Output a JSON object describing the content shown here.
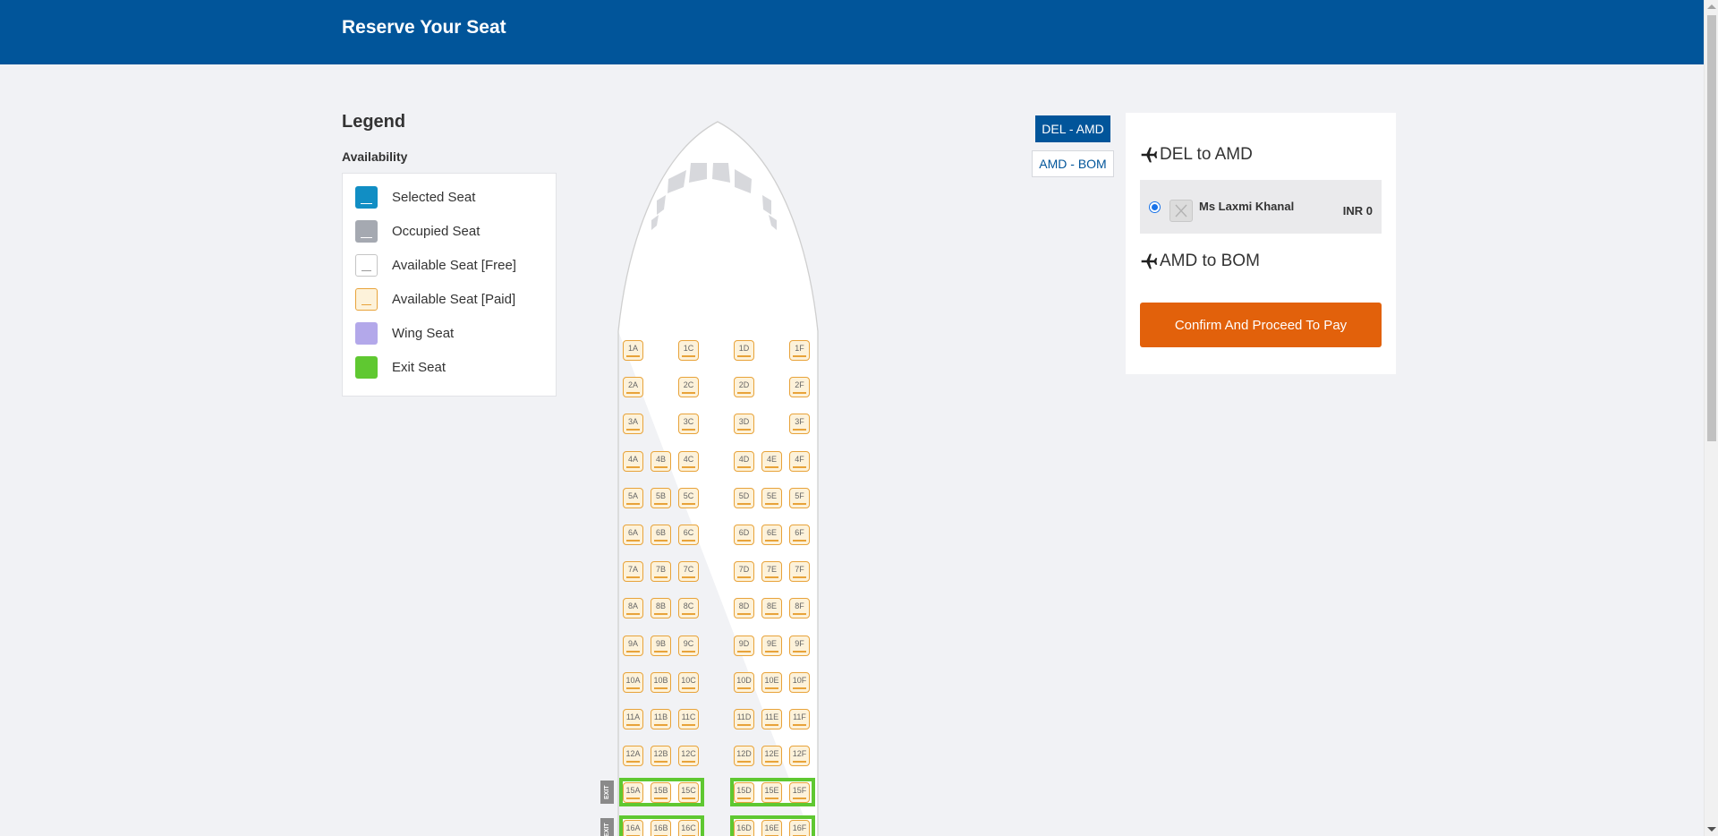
{
  "header": {
    "title": "Reserve Your Seat"
  },
  "legend": {
    "title": "Legend",
    "subtitle": "Availability",
    "items": [
      {
        "label": "Selected Seat",
        "color": "#118ec4",
        "line": "#ffffff"
      },
      {
        "label": "Occupied Seat",
        "color": "#a5a9b1",
        "line": "#ffffff"
      },
      {
        "label": "Available Seat [Free]",
        "color": "#ffffff",
        "line": "#9a9a9a"
      },
      {
        "label": "Available Seat [Paid]",
        "color": "#fdf2da",
        "line": "#e8a33a"
      },
      {
        "label": "Wing Seat",
        "color": "#b3a8ea",
        "line": ""
      },
      {
        "label": "Exit Seat",
        "color": "#5fc831",
        "line": ""
      }
    ]
  },
  "seatmap": {
    "exit_label": "EXIT",
    "rows": [
      {
        "row": "1",
        "seats": [
          "1A",
          "1C",
          "1D",
          "1F"
        ]
      },
      {
        "row": "2",
        "seats": [
          "2A",
          "2C",
          "2D",
          "2F"
        ]
      },
      {
        "row": "3",
        "seats": [
          "3A",
          "3C",
          "3D",
          "3F"
        ]
      },
      {
        "row": "4",
        "seats": [
          "4A",
          "4B",
          "4C",
          "4D",
          "4E",
          "4F"
        ]
      },
      {
        "row": "5",
        "seats": [
          "5A",
          "5B",
          "5C",
          "5D",
          "5E",
          "5F"
        ]
      },
      {
        "row": "6",
        "seats": [
          "6A",
          "6B",
          "6C",
          "6D",
          "6E",
          "6F"
        ]
      },
      {
        "row": "7",
        "seats": [
          "7A",
          "7B",
          "7C",
          "7D",
          "7E",
          "7F"
        ]
      },
      {
        "row": "8",
        "seats": [
          "8A",
          "8B",
          "8C",
          "8D",
          "8E",
          "8F"
        ]
      },
      {
        "row": "9",
        "seats": [
          "9A",
          "9B",
          "9C",
          "9D",
          "9E",
          "9F"
        ]
      },
      {
        "row": "10",
        "seats": [
          "10A",
          "10B",
          "10C",
          "10D",
          "10E",
          "10F"
        ]
      },
      {
        "row": "11",
        "seats": [
          "11A",
          "11B",
          "11C",
          "11D",
          "11E",
          "11F"
        ]
      },
      {
        "row": "12",
        "seats": [
          "12A",
          "12B",
          "12C",
          "12D",
          "12E",
          "12F"
        ]
      },
      {
        "row": "15",
        "exit": true,
        "seats": [
          "15A",
          "15B",
          "15C",
          "15D",
          "15E",
          "15F"
        ]
      },
      {
        "row": "16",
        "exit": true,
        "seats": [
          "16A",
          "16B",
          "16C",
          "16D",
          "16E",
          "16F"
        ]
      }
    ]
  },
  "sector_tabs": [
    {
      "label": "DEL - AMD",
      "active": true
    },
    {
      "label": "AMD - BOM",
      "active": false
    }
  ],
  "panel": {
    "sectors": [
      {
        "title": "DEL to AMD",
        "passengers": [
          {
            "name": "Ms Laxmi Khanal",
            "price": "INR 0",
            "selected": true
          }
        ]
      },
      {
        "title": "AMD to BOM",
        "passengers": []
      }
    ],
    "confirm_label": "Confirm And Proceed To Pay"
  }
}
